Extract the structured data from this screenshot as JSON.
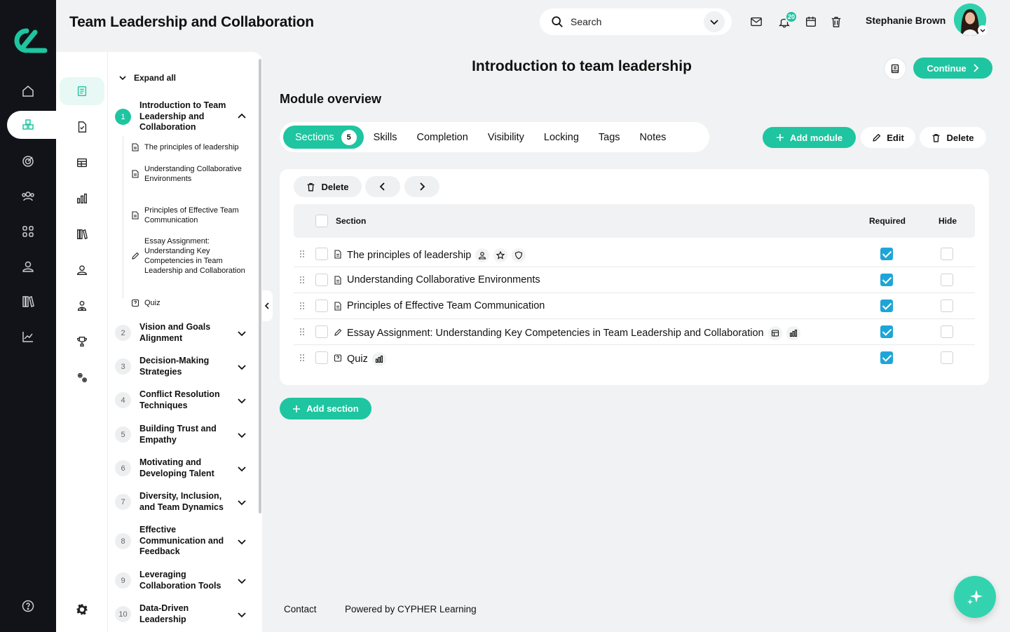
{
  "header": {
    "title": "Team Leadership and Collaboration",
    "search_placeholder": "Search",
    "notification_count": "20",
    "user_name": "Stephanie Brown"
  },
  "main": {
    "title": "Introduction to team leadership",
    "continue_label": "Continue",
    "overview_heading": "Module overview",
    "add_module_label": "Add module",
    "edit_label": "Edit",
    "delete_label": "Delete",
    "add_section_label": "Add section",
    "tabs": [
      {
        "label": "Sections",
        "count": "5"
      },
      {
        "label": "Skills"
      },
      {
        "label": "Completion"
      },
      {
        "label": "Visibility"
      },
      {
        "label": "Locking"
      },
      {
        "label": "Tags"
      },
      {
        "label": "Notes"
      }
    ]
  },
  "table": {
    "toolbar_delete": "Delete",
    "col_section": "Section",
    "col_required": "Required",
    "col_hide": "Hide",
    "rows": [
      {
        "title": "The principles of leadership",
        "icon": "page-icon",
        "required": true,
        "hide": false
      },
      {
        "title": "Understanding Collaborative Environments",
        "icon": "page-icon",
        "required": true,
        "hide": false
      },
      {
        "title": "Principles of Effective Team Communication",
        "icon": "page-icon",
        "required": true,
        "hide": false
      },
      {
        "title": "Essay Assignment: Understanding Key Competencies in Team Leadership and Collaboration",
        "icon": "pencil-icon",
        "required": true,
        "hide": false
      },
      {
        "title": "Quiz",
        "icon": "quiz-icon",
        "required": true,
        "hide": false
      }
    ]
  },
  "tree": {
    "expand_all": "Expand all",
    "modules": [
      {
        "num": "1",
        "label": "Introduction to Team Leadership and Collaboration",
        "expanded": true
      },
      {
        "num": "2",
        "label": "Vision and Goals Alignment"
      },
      {
        "num": "3",
        "label": "Decision-Making Strategies"
      },
      {
        "num": "4",
        "label": "Conflict Resolution Techniques"
      },
      {
        "num": "5",
        "label": "Building Trust and Empathy"
      },
      {
        "num": "6",
        "label": "Motivating and Developing Talent"
      },
      {
        "num": "7",
        "label": "Diversity, Inclusion, and Team Dynamics"
      },
      {
        "num": "8",
        "label": "Effective Communication and Feedback"
      },
      {
        "num": "9",
        "label": "Leveraging Collaboration Tools"
      },
      {
        "num": "10",
        "label": "Data-Driven Leadership"
      }
    ],
    "subitems": [
      {
        "label": "The principles of leadership",
        "icon": "page-icon"
      },
      {
        "label": "Understanding Collaborative Environments",
        "icon": "page-icon"
      },
      {
        "label": "Principles of Effective Team Communication",
        "icon": "page-icon"
      },
      {
        "label": "Essay Assignment: Understanding Key Competencies in Team Leadership and Collaboration",
        "icon": "pencil-icon"
      },
      {
        "label": "Quiz",
        "icon": "quiz-icon"
      }
    ]
  },
  "footer": {
    "contact": "Contact",
    "powered": "Powered by CYPHER Learning"
  },
  "colors": {
    "accent": "#1ec5a0",
    "checkbox": "#1ea5d8",
    "rail": "#111318"
  }
}
